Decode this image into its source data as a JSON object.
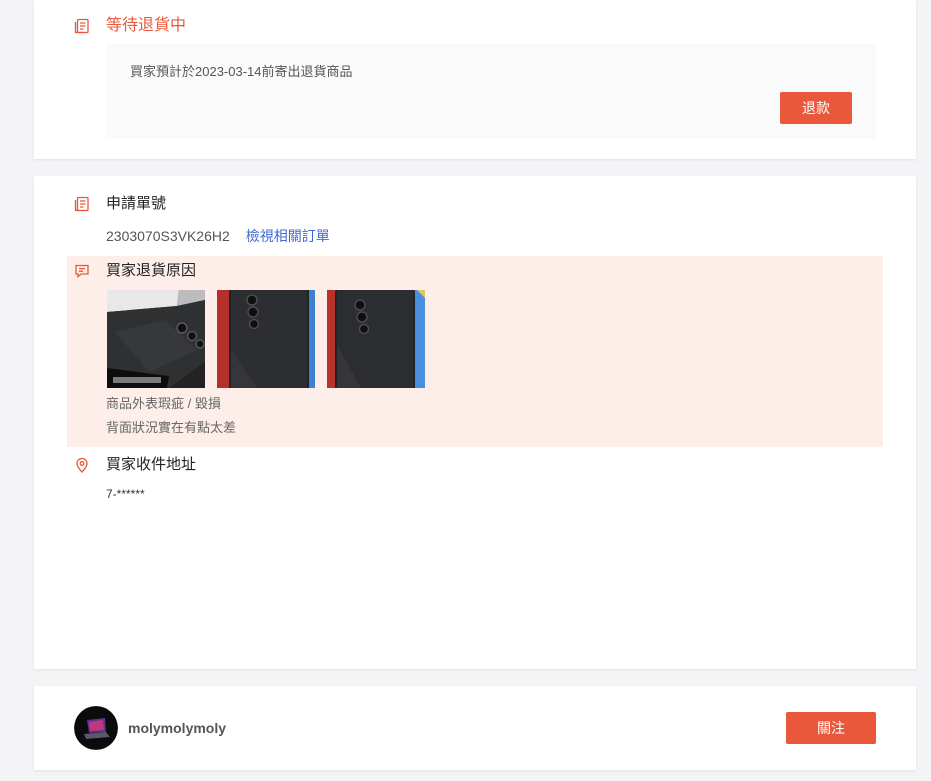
{
  "colors": {
    "accent": "#e9583b",
    "link": "#4169d4",
    "reason_highlight": "#fdeeea",
    "page_background": "#f4f4f7"
  },
  "return_status": {
    "icon": "document-list-icon",
    "title": "等待退貨中",
    "message": "買家預計於2023-03-14前寄出退貨商品",
    "refund_button": "退款"
  },
  "request": {
    "icon": "document-list-icon",
    "heading": "申請單號",
    "number": "2303070S3VK26H2",
    "view_related_orders_link": "檢視相關訂單"
  },
  "return_reason": {
    "icon": "chat-bubble-icon",
    "heading": "買家退貨原因",
    "reason": "商品外表瑕疵 / 毀損",
    "comment": "背面狀況實在有點太差"
  },
  "shipping_address": {
    "icon": "location-pin-icon",
    "heading": "買家收件地址",
    "address": "7-******"
  },
  "user": {
    "username": "molymolymoly",
    "follow_button": "關注"
  }
}
